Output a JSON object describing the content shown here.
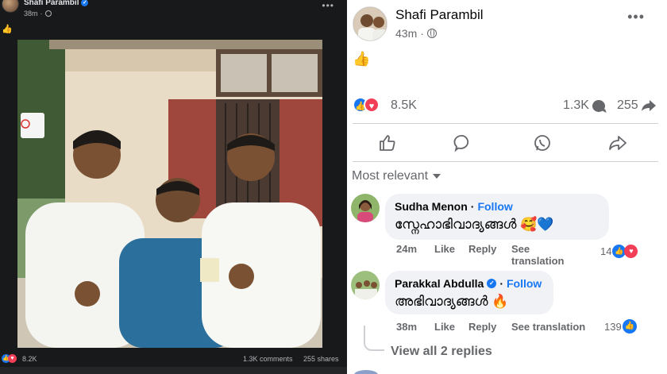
{
  "left_post": {
    "author": "Shafi Parambil",
    "time": "38m",
    "privacy_icon": "globe-icon",
    "body_emoji": "👍",
    "reaction_count": "8.2K",
    "comments": "1.3K comments",
    "shares": "255 shares"
  },
  "right_post": {
    "author": "Shafi Parambil",
    "time": "43m",
    "body_emoji": "👍",
    "reaction_count": "8.5K",
    "comment_count": "1.3K",
    "share_count": "255",
    "sort_label": "Most relevant"
  },
  "comments": [
    {
      "author": "Sudha Menon",
      "follow": "Follow",
      "text": "സ്നേഹാഭിവാദ്യങ്ങൾ 🥰💙",
      "time": "24m",
      "like": "Like",
      "reply": "Reply",
      "see_translation": "See translation",
      "reactions": "14"
    },
    {
      "author": "Parakkal Abdulla",
      "follow": "Follow",
      "text": "അഭിവാദ്യങ്ങൾ 🔥",
      "time": "38m",
      "like": "Like",
      "reply": "Reply",
      "see_translation": "See translation",
      "reactions": "139"
    }
  ],
  "view_replies": "View all 2 replies",
  "colors": {
    "facebook_blue": "#1877f2",
    "love_red": "#f33e58",
    "dark_bg": "#18191a",
    "secondary_text": "#65676b"
  }
}
